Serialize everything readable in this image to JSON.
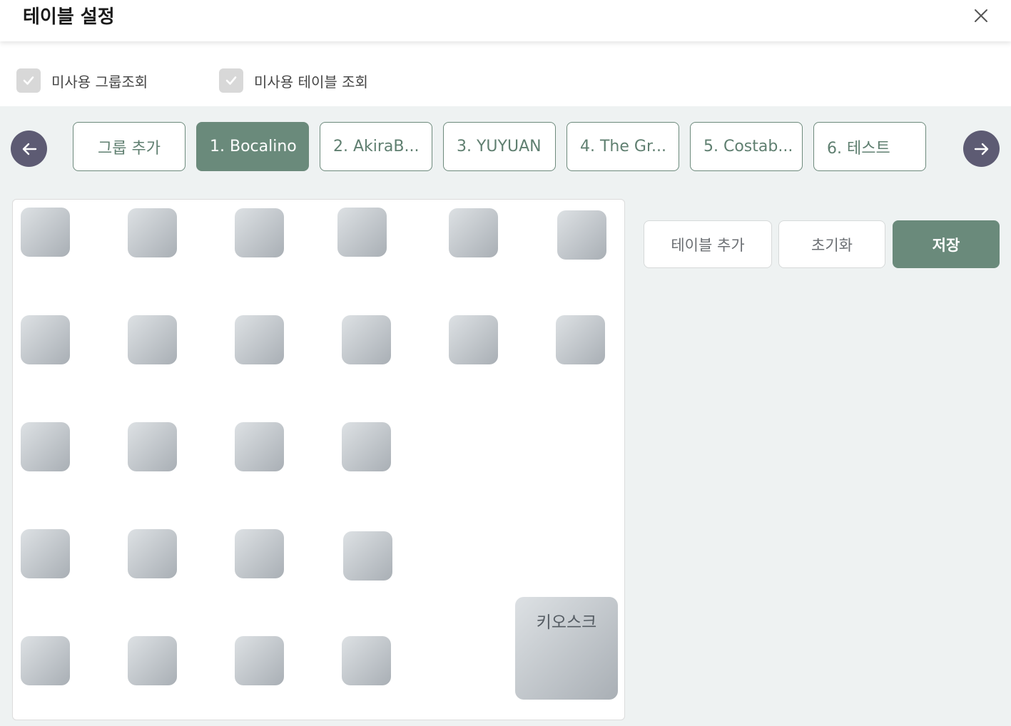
{
  "header": {
    "title": "테이블 설정",
    "close_icon": "close-icon"
  },
  "filters": [
    {
      "label": "미사용 그룹조회",
      "checked": true
    },
    {
      "label": "미사용 테이블 조회",
      "checked": true
    }
  ],
  "group_tabs": {
    "prev_icon": "arrow-left-icon",
    "next_icon": "arrow-right-icon",
    "add_label": "그룹 추가",
    "items": [
      {
        "label": "1. Bocalino",
        "active": true
      },
      {
        "label": "2. AkiraB...",
        "active": false
      },
      {
        "label": "3. YUYUAN",
        "active": false
      },
      {
        "label": "4. The Gr...",
        "active": false
      },
      {
        "label": "5. Costab...",
        "active": false
      },
      {
        "label": "6. 테스트",
        "active": false
      }
    ]
  },
  "floor": {
    "table_count": 26,
    "kiosk_label": "키오스크"
  },
  "actions": {
    "add_table": "테이블 추가",
    "reset": "초기화",
    "save": "저장"
  },
  "colors": {
    "accent": "#6a8a7b",
    "nav_button": "#5d5b73",
    "background": "#eef2f2",
    "table_tile": "#c4c9cd"
  }
}
